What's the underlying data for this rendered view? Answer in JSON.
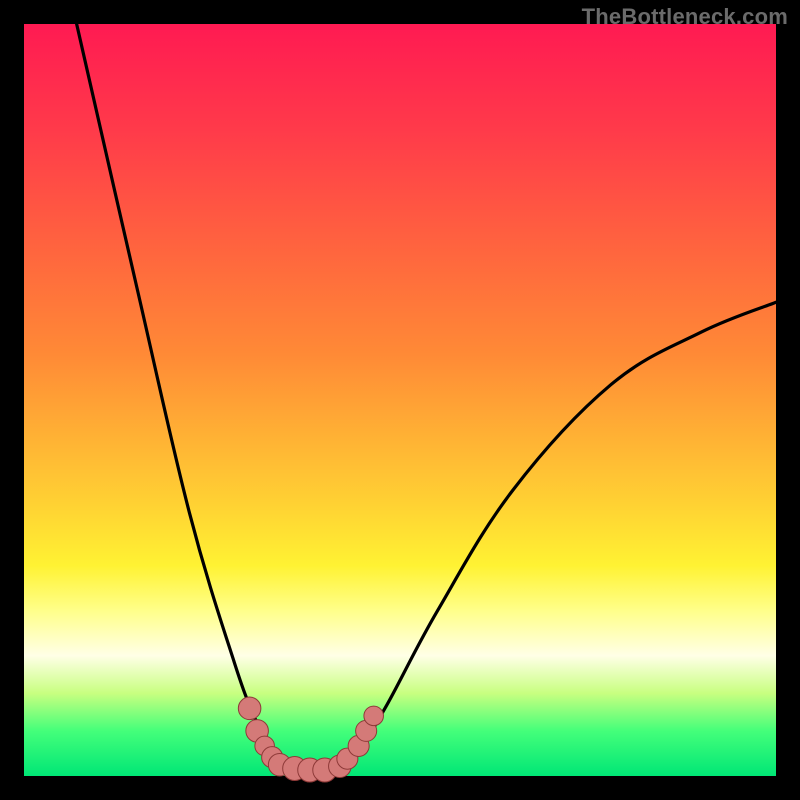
{
  "watermark": "TheBottleneck.com",
  "colors": {
    "background": "#000000",
    "curve_stroke": "#000000",
    "marker_fill": "#d47a78",
    "marker_stroke": "#8e3a38"
  },
  "chart_data": {
    "type": "line",
    "title": "",
    "xlabel": "",
    "ylabel": "",
    "xlim": [
      0,
      100
    ],
    "ylim": [
      0,
      100
    ],
    "grid": false,
    "legend": false,
    "curve_points": [
      {
        "x": 7,
        "y": 100
      },
      {
        "x": 15,
        "y": 65
      },
      {
        "x": 22,
        "y": 35
      },
      {
        "x": 28,
        "y": 15
      },
      {
        "x": 31,
        "y": 7
      },
      {
        "x": 33,
        "y": 3
      },
      {
        "x": 36,
        "y": 1
      },
      {
        "x": 40,
        "y": 1
      },
      {
        "x": 44,
        "y": 3
      },
      {
        "x": 48,
        "y": 9
      },
      {
        "x": 55,
        "y": 22
      },
      {
        "x": 65,
        "y": 38
      },
      {
        "x": 78,
        "y": 52
      },
      {
        "x": 90,
        "y": 59
      },
      {
        "x": 100,
        "y": 63
      }
    ],
    "markers": [
      {
        "x": 30,
        "y": 9,
        "r": 1.5
      },
      {
        "x": 31,
        "y": 6,
        "r": 1.5
      },
      {
        "x": 32,
        "y": 4,
        "r": 1.3
      },
      {
        "x": 33,
        "y": 2.5,
        "r": 1.4
      },
      {
        "x": 34,
        "y": 1.5,
        "r": 1.5
      },
      {
        "x": 36,
        "y": 1,
        "r": 1.6
      },
      {
        "x": 38,
        "y": 0.8,
        "r": 1.6
      },
      {
        "x": 40,
        "y": 0.8,
        "r": 1.6
      },
      {
        "x": 42,
        "y": 1.3,
        "r": 1.5
      },
      {
        "x": 43,
        "y": 2.3,
        "r": 1.4
      },
      {
        "x": 44.5,
        "y": 4,
        "r": 1.4
      },
      {
        "x": 45.5,
        "y": 6,
        "r": 1.4
      },
      {
        "x": 46.5,
        "y": 8,
        "r": 1.3
      }
    ]
  }
}
